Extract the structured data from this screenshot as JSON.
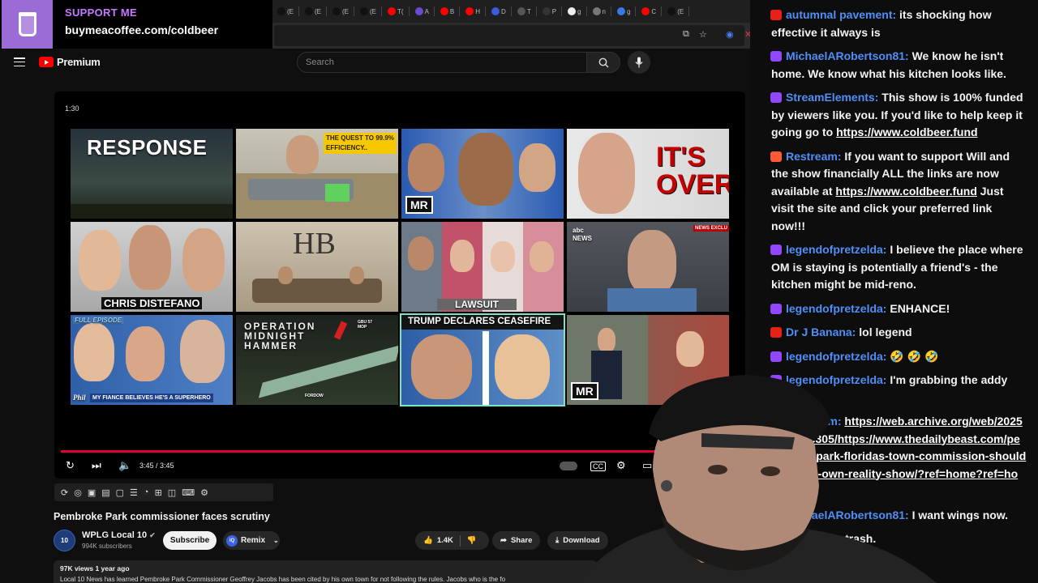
{
  "support": {
    "label": "SUPPORT ME",
    "url": "buymeacoffee.com/coldbeer"
  },
  "tabs": [
    {
      "icon": "tiktok-icon",
      "label": "(E",
      "color": "#111"
    },
    {
      "icon": "tiktok-icon",
      "label": "(E",
      "color": "#111"
    },
    {
      "icon": "tiktok-icon",
      "label": "(E",
      "color": "#111"
    },
    {
      "icon": "tiktok-icon",
      "label": "(E",
      "color": "#111"
    },
    {
      "icon": "youtube-icon",
      "label": "T(",
      "color": "#ff0000"
    },
    {
      "icon": "globe-icon",
      "label": "A",
      "color": "#6a4bd0"
    },
    {
      "icon": "youtube-icon",
      "label": "B",
      "color": "#ff0000"
    },
    {
      "icon": "youtube-icon",
      "label": "H",
      "color": "#ff0000"
    },
    {
      "icon": "t-icon",
      "label": "D",
      "color": "#3b5bdb"
    },
    {
      "icon": "circle-icon",
      "label": "T",
      "color": "#555"
    },
    {
      "icon": "p-icon",
      "label": "P",
      "color": "#333"
    },
    {
      "icon": "google-icon",
      "label": "g",
      "color": "#eee"
    },
    {
      "icon": "globe-icon",
      "label": "n",
      "color": "#777"
    },
    {
      "icon": "globe-icon",
      "label": "g",
      "color": "#3b78e7"
    },
    {
      "icon": "youtube-icon",
      "label": "C",
      "color": "#ff0000"
    },
    {
      "icon": "tiktok-icon",
      "label": "(E",
      "color": "#111"
    }
  ],
  "header": {
    "brand": "Premium",
    "search_placeholder": "Search"
  },
  "player": {
    "countdown": "1:30",
    "time": "3:45 / 3:45",
    "progress_fraction": 1.0,
    "endscreen": [
      {
        "label": "RESPONSE"
      },
      {
        "label": "THE QUEST TO 99.9% EFFICIENCY.."
      },
      {
        "label": "MR"
      },
      {
        "label": "IT'S OVER"
      },
      {
        "label": "CHRIS DISTEFANO"
      },
      {
        "label": "HB"
      },
      {
        "label": "LAWSUIT"
      },
      {
        "label": "abc NEWS",
        "tag": "NEWS EXCLU"
      },
      {
        "label": "FULL EPISODE",
        "caption": "MY FIANCE BELIEVES HE'S A SUPERHERO",
        "logo": "Phil"
      },
      {
        "label": "OPERATION MIDNIGHT HAMMER",
        "tag1": "GBU 57 MOP",
        "tag2": "FORDOW"
      },
      {
        "label": "TRUMP DECLARES CEASEFIRE"
      },
      {
        "label": "MR"
      }
    ]
  },
  "video": {
    "title": "Pembroke Park commissioner faces scrutiny",
    "channel": "WPLG Local 10",
    "avatar": "10",
    "subscribers": "994K subscribers",
    "subscribe": "Subscribe",
    "remix": "Remix",
    "likes": "1.4K",
    "share": "Share",
    "download": "Download",
    "meta": "97K views  1 year ago",
    "description": "Local 10 News has learned Pembroke Park Commissioner Geoffrey Jacobs has been cited by his own town for not following the rules. Jacobs who is the fo"
  },
  "chat": [
    {
      "platform": "youtube",
      "badge": "#e62117",
      "user": "autumnal pavement:",
      "user_color": "#4f8ff7",
      "text": "its shocking how effective it always is"
    },
    {
      "platform": "twitch",
      "badge": "#9146ff",
      "user": "MichaelARobertson81:",
      "user_color": "#4f8ff7",
      "text": "We know he isn't home. We know what his kitchen looks like."
    },
    {
      "platform": "twitch",
      "badge": "#9146ff",
      "user": "StreamElements:",
      "user_color": "#4f8ff7",
      "text": "This show is 100% funded by viewers like you. If you'd like to help keep it going go to",
      "link": "https://www.coldbeer.fund"
    },
    {
      "platform": "restream",
      "badge": "#ff5a36",
      "user": "Restream:",
      "user_color": "#4f8ff7",
      "text": "If you want to support Will and the show financially ALL the links are now available at",
      "link": "https://www.coldbeer.fund",
      "text2": "Just visit the site and click your preferred link now!!!"
    },
    {
      "platform": "twitch",
      "badge": "#9146ff",
      "user": "legendofpretzelda:",
      "user_color": "#4f8ff7",
      "text": "I believe the place where OM is staying is potentially a friend's - the kitchen might be mid-reno."
    },
    {
      "platform": "twitch",
      "badge": "#9146ff",
      "user": "legendofpretzelda:",
      "user_color": "#4f8ff7",
      "text": "ENHANCE!"
    },
    {
      "platform": "youtube",
      "badge": "#e62117",
      "user": "Dr J Banana:",
      "user_color": "#4f8ff7",
      "text": "lol legend"
    },
    {
      "platform": "twitch",
      "badge": "#9146ff",
      "user": "legendofpretzelda:",
      "user_color": "#4f8ff7",
      "text": "🤣 🤣 🤣"
    },
    {
      "platform": "twitch",
      "badge": "#9146ff",
      "user": "legendofpretzelda:",
      "user_color": "#4f8ff7",
      "text": "I'm grabbing the addy now lol"
    },
    {
      "platform": "restream",
      "badge": "#ff5a36",
      "user": "Restream:",
      "user_color": "#4f8ff7",
      "text": "",
      "link": "https://web.archive.org/web/20250308023305/https://www.thedailybeast.com/pembroke-park-floridas-town-commission-should-have-its-own-reality-show/?ref=home?ref=home"
    },
    {
      "platform": "twitch",
      "badge": "#9146ff",
      "user": "MichaelARobertson81:",
      "user_color": "#4f8ff7",
      "text": "I want wings now."
    },
    {
      "platform": "twitch",
      "badge": "#9146ff",
      "user": "",
      "user_color": "#4f8ff7",
      "text": "this guy is trash."
    }
  ]
}
